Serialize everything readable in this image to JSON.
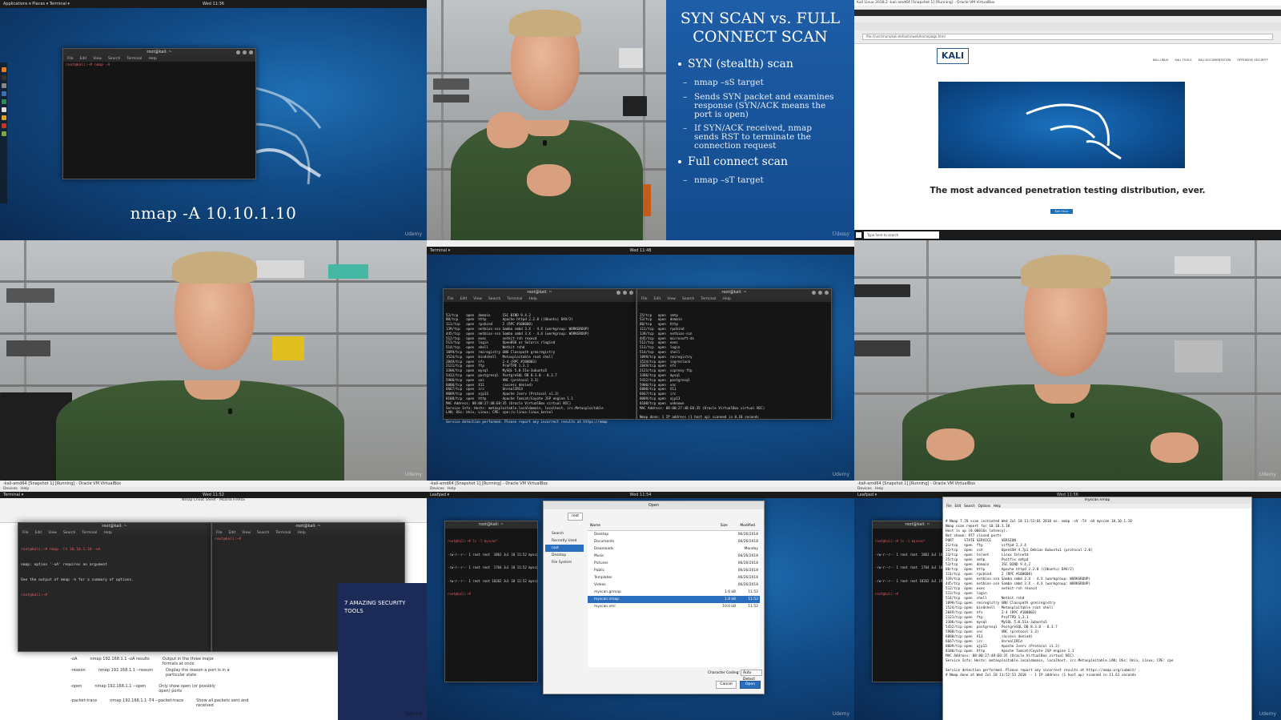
{
  "cell1": {
    "topbar_left": "Applications ▾   Places ▾   Terminal ▾",
    "clock": "Wed 11:36",
    "terminal_title": "root@kali: ~",
    "terminal_menu": [
      "File",
      "Edit",
      "View",
      "Search",
      "Terminal",
      "Help"
    ],
    "command": "root@kali:~# nmap -A ",
    "caption": "nmap -A 10.10.1.10",
    "watermark": "Udemy"
  },
  "slide": {
    "title": "SYN SCAN vs. FULL CONNECT SCAN",
    "bullet1": "SYN (stealth) scan",
    "sub1": "nmap –sS target",
    "sub2": "Sends SYN packet and examines response (SYN/ACK means the port is open)",
    "sub3": "If SYN/ACK received, nmap sends RST to terminate the connection request",
    "bullet2": "Full connect scan",
    "sub4": "nmap –sT target",
    "watermark": "Udemy"
  },
  "kali_site": {
    "window_title": "Kali Linux 2018.2 -kali amd64 [Snapshot 1] [Running] - Oracle VM VirtualBox",
    "url": "file:///usr/share/kali-defaults/web/homepage.html",
    "logo": "KALI",
    "nav": [
      "KALI LINUX",
      "KALI TOOLS",
      "KALI DOCUMENTATION",
      "OFFENSIVE SECURITY"
    ],
    "tagline": "The most advanced penetration testing distribution, ever.",
    "button": "Kali Linux",
    "taskbar_search": "Type here to search"
  },
  "cell5": {
    "clock": "Wed 11:48",
    "left_title": "root@kali: ~",
    "right_title": "root@kali: ~",
    "left_lines": [
      "53/tcp    open  domain      ISC BIND 9.4.2",
      "80/tcp    open  http        Apache httpd 2.2.8 ((Ubuntu) DAV/2)",
      "111/tcp   open  rpcbind     2 (RPC #100000)",
      "139/tcp   open  netbios-ssn Samba smbd 3.X - 4.X (workgroup: WORKGROUP)",
      "445/tcp   open  netbios-ssn Samba smbd 3.X - 4.X (workgroup: WORKGROUP)",
      "512/tcp   open  exec        netkit-rsh rexecd",
      "513/tcp   open  login       OpenBSD or Solaris rlogind",
      "514/tcp   open  shell       Netkit rshd",
      "1099/tcp  open  rmiregistry GNU Classpath grmiregistry",
      "1524/tcp  open  bindshell   Metasploitable root shell",
      "2049/tcp  open  nfs         2-4 (RPC #100003)",
      "2121/tcp  open  ftp         ProFTPD 1.3.1",
      "3306/tcp  open  mysql       MySQL 5.0.51a-3ubuntu5",
      "5432/tcp  open  postgresql  PostgreSQL DB 8.3.0 - 8.3.7",
      "5900/tcp  open  vnc         VNC (protocol 3.3)",
      "6000/tcp  open  X11         (access denied)",
      "6667/tcp  open  irc         UnrealIRCd",
      "8009/tcp  open  ajp13       Apache Jserv (Protocol v1.3)",
      "8180/tcp  open  http        Apache Tomcat/Coyote JSP engine 1.1",
      "MAC Address: 08:00:27:48:E0:35 (Oracle VirtualBox virtual NIC)",
      "Service Info: Hosts: metasploitable.localdomain, localhost, irc.Metasploitable",
      "LAN; OSs: Unix, Linux; CPE: cpe:/o:linux:linux_kernel",
      "",
      "Service detection performed. Please report any incorrect results at https://nmap"
    ],
    "right_lines": [
      "25/tcp   open  smtp",
      "53/tcp   open  domain",
      "80/tcp   open  http",
      "111/tcp  open  rpcbind",
      "139/tcp  open  netbios-ssn",
      "445/tcp  open  microsoft-ds",
      "512/tcp  open  exec",
      "513/tcp  open  login",
      "514/tcp  open  shell",
      "1099/tcp open  rmiregistry",
      "1524/tcp open  ingreslock",
      "2049/tcp open  nfs",
      "2121/tcp open  ccproxy-ftp",
      "3306/tcp open  mysql",
      "5432/tcp open  postgresql",
      "5900/tcp open  vnc",
      "6000/tcp open  X11",
      "6667/tcp open  irc",
      "8009/tcp open  ajp13",
      "8180/tcp open  unknown",
      "MAC Address: 08:00:27:48:E0:35 (Oracle VirtualBox virtual NIC)",
      "",
      "Nmap done: 1 IP address (1 host up) scanned in 0.18 seconds"
    ],
    "watermark": "Udemy"
  },
  "cell7": {
    "window_title": "-kali-amd64 [Snapshot 1] [Running] - Oracle VM VirtualBox",
    "browser_title": "Nmap Cheat Sheet - Mozilla Firefox",
    "clock": "Wed 11:52",
    "term_title": "root@kali: ~",
    "lines": [
      "root@kali:~# nmap -T4 10.10.1.10 -oA",
      "nmap: option '-oA' requires an argument",
      "See the output of nmap -h for a summary of options.",
      "root@kali:~# "
    ],
    "sheet_rows": [
      [
        "-oA",
        "nmap 192.168.1.1 -oA results",
        "Output in the three major formats at once"
      ],
      [
        "-reason",
        "nmap 192.168.1.1 --reason",
        "Display the reason a port is in a particular state"
      ],
      [
        "-open",
        "nmap 192.168.1.1 --open",
        "Only show open (or possibly open) ports"
      ],
      [
        "-packet-trace",
        "nmap 192.168.1.1 -T4 --packet-trace",
        "Show all packets sent and received"
      ]
    ],
    "promo_text": "7 AMAZING SECURITY TOOLS",
    "watermark": "Udemy"
  },
  "cell8": {
    "window_title": "-kali-amd64 [Snapshot 1] [Running] - Oracle VM VirtualBox",
    "clock": "Wed 11:54",
    "dialog_title": "Open",
    "path": "root",
    "places": [
      "Search",
      "Recently Used",
      "root",
      "Desktop",
      "File System"
    ],
    "columns": [
      "Name",
      "Size",
      "Modified"
    ],
    "files": [
      {
        "name": "Desktop",
        "size": "",
        "mod": "06/26/2018"
      },
      {
        "name": "Documents",
        "size": "",
        "mod": "06/26/2018"
      },
      {
        "name": "Downloads",
        "size": "",
        "mod": "Monday"
      },
      {
        "name": "Music",
        "size": "",
        "mod": "06/26/2018"
      },
      {
        "name": "Pictures",
        "size": "",
        "mod": "06/26/2018"
      },
      {
        "name": "Public",
        "size": "",
        "mod": "06/26/2018"
      },
      {
        "name": "Templates",
        "size": "",
        "mod": "06/26/2018"
      },
      {
        "name": "Videos",
        "size": "",
        "mod": "06/26/2018"
      },
      {
        "name": "myscan.gnmap",
        "size": "1.6 kB",
        "mod": "11:52"
      },
      {
        "name": "myscan.nmap",
        "size": "1.8 kB",
        "mod": "11:52"
      },
      {
        "name": "myscan.xml",
        "size": "10.0 kB",
        "mod": "11:52"
      }
    ],
    "encoding_label": "Character Coding:",
    "encoding_value": "Auto Detect",
    "cancel": "Cancel",
    "open": "Open",
    "watermark": "Udemy"
  },
  "cell9": {
    "window_title": "-kali-amd64 [Snapshot 1] [Running] - Oracle VM VirtualBox",
    "clock": "Wed 11:56",
    "editor_title": "myscan.nmap",
    "left_lines": [
      "root@kali:~# ls -l myscan*",
      "-rw-r--r-- 1 root root  1861 Jul 18 11:52 myscan.gnmap",
      "-rw-r--r-- 1 root root  1764 Jul 18 11:52 myscan.nmap",
      "-rw-r--r-- 1 root root 10262 Jul 18 11:52 myscan.xml",
      "root@kali:~# "
    ],
    "editor_lines": [
      "# Nmap 7.70 scan initiated Wed Jul 18 11:52:01 2018 as: nmap -sV -T4 -oA myscan 10.10.1.10",
      "Nmap scan report for 10.10.1.10",
      "Host is up (0.00016s latency).",
      "Not shown: 977 closed ports",
      "PORT     STATE SERVICE     VERSION",
      "21/tcp   open  ftp         vsftpd 2.3.4",
      "22/tcp   open  ssh         OpenSSH 4.7p1 Debian 8ubuntu1 (protocol 2.0)",
      "23/tcp   open  telnet      Linux telnetd",
      "25/tcp   open  smtp        Postfix smtpd",
      "53/tcp   open  domain      ISC BIND 9.4.2",
      "80/tcp   open  http        Apache httpd 2.2.8 ((Ubuntu) DAV/2)",
      "111/tcp  open  rpcbind     2 (RPC #100000)",
      "139/tcp  open  netbios-ssn Samba smbd 3.X - 4.X (workgroup: WORKGROUP)",
      "445/tcp  open  netbios-ssn Samba smbd 3.X - 4.X (workgroup: WORKGROUP)",
      "512/tcp  open  exec        netkit-rsh rexecd",
      "513/tcp  open  login",
      "514/tcp  open  shell       Netkit rshd",
      "1099/tcp open  rmiregistry GNU Classpath grmiregistry",
      "1524/tcp open  bindshell   Metasploitable root shell",
      "2049/tcp open  nfs         2-4 (RPC #100003)",
      "2121/tcp open  ftp         ProFTPD 1.3.1",
      "3306/tcp open  mysql       MySQL 5.0.51a-3ubuntu5",
      "5432/tcp open  postgresql  PostgreSQL DB 8.3.0 - 8.3.7",
      "5900/tcp open  vnc         VNC (protocol 3.3)",
      "6000/tcp open  X11         (access denied)",
      "6667/tcp open  irc         UnrealIRCd",
      "8009/tcp open  ajp13       Apache Jserv (Protocol v1.3)",
      "8180/tcp open  http        Apache Tomcat/Coyote JSP engine 1.1",
      "MAC Address: 08:00:27:48:E0:35 (Oracle VirtualBox virtual NIC)",
      "Service Info: Hosts: metasploitable.localdomain, localhost, irc.Metasploitable.LAN; OSs: Unix, Linux; CPE: cpe",
      "",
      "Service detection performed. Please report any incorrect results at https://nmap.org/submit/ .",
      "# Nmap done at Wed Jul 18 11:52:53 2018 -- 1 IP address (1 host up) scanned in 11.61 seconds"
    ],
    "watermark": "Udemy"
  }
}
